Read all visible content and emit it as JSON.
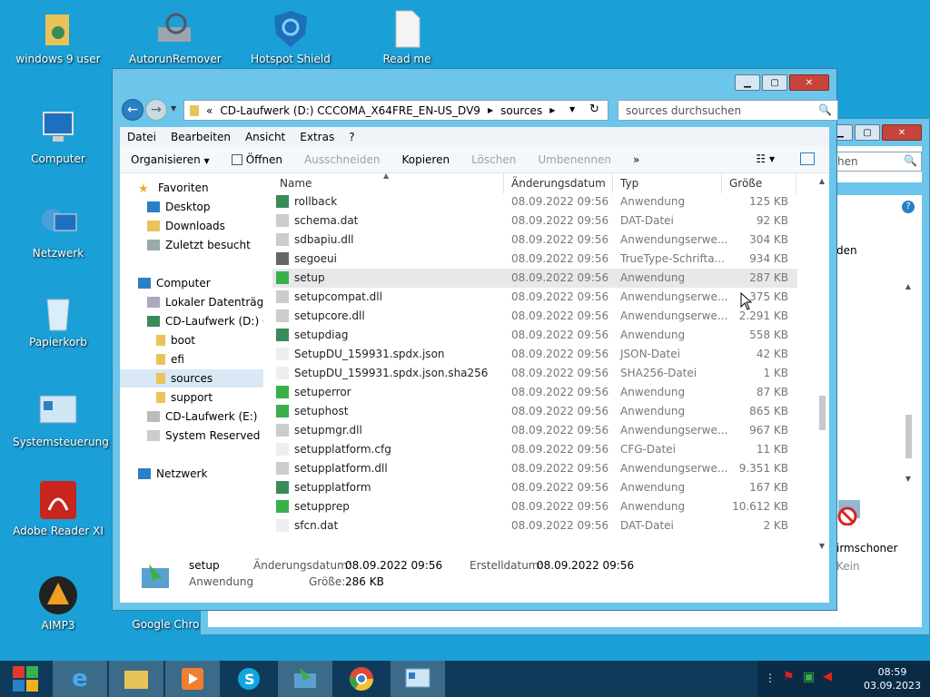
{
  "desktop": {
    "icons": [
      {
        "label": "windows 9 user"
      },
      {
        "label": "AutorunRemover"
      },
      {
        "label": "Hotspot Shield"
      },
      {
        "label": "Read me"
      },
      {
        "label": "Computer"
      },
      {
        "label": "Netzwerk"
      },
      {
        "label": "Papierkorb"
      },
      {
        "label": "Systemsteuerung"
      },
      {
        "label": "Adobe Reader XI"
      },
      {
        "label": "AIMP3"
      },
      {
        "label": "Google Chrome"
      }
    ]
  },
  "bg_window": {
    "search_partial": "hen",
    "text_partial": "den",
    "icon_label": "irmschoner",
    "icon_sub": "Kein"
  },
  "window": {
    "address": {
      "chevron": "«",
      "segments": [
        "CD-Laufwerk (D:) CCCOMA_X64FRE_EN-US_DV9",
        "sources"
      ]
    },
    "search_placeholder": "sources durchsuchen",
    "menu": [
      "Datei",
      "Bearbeiten",
      "Ansicht",
      "Extras",
      "?"
    ],
    "toolbar": {
      "organize": "Organisieren",
      "open": "Öffnen",
      "cut": "Ausschneiden",
      "copy": "Kopieren",
      "delete": "Löschen",
      "rename": "Umbenennen",
      "more": "»"
    },
    "nav": {
      "favorites": "Favoriten",
      "desktop": "Desktop",
      "downloads": "Downloads",
      "recent": "Zuletzt besucht",
      "computer": "Computer",
      "local": "Lokaler Datenträger",
      "cd_d": "CD-Laufwerk (D:) CC",
      "boot": "boot",
      "efi": "efi",
      "sources": "sources",
      "support": "support",
      "cd_e": "CD-Laufwerk (E:)",
      "sysres": "System Reserved (F:)",
      "network": "Netzwerk"
    },
    "columns": {
      "name": "Name",
      "date": "Änderungsdatum",
      "type": "Typ",
      "size": "Größe"
    },
    "files": [
      {
        "name": "rollback",
        "date": "08.09.2022 09:56",
        "type": "Anwendung",
        "size": "125 KB"
      },
      {
        "name": "schema.dat",
        "date": "08.09.2022 09:56",
        "type": "DAT-Datei",
        "size": "92 KB"
      },
      {
        "name": "sdbapiu.dll",
        "date": "08.09.2022 09:56",
        "type": "Anwendungserwe...",
        "size": "304 KB"
      },
      {
        "name": "segoeui",
        "date": "08.09.2022 09:56",
        "type": "TrueType-Schrifta...",
        "size": "934 KB"
      },
      {
        "name": "setup",
        "date": "08.09.2022 09:56",
        "type": "Anwendung",
        "size": "287 KB"
      },
      {
        "name": "setupcompat.dll",
        "date": "08.09.2022 09:56",
        "type": "Anwendungserwe...",
        "size": "375 KB"
      },
      {
        "name": "setupcore.dll",
        "date": "08.09.2022 09:56",
        "type": "Anwendungserwe...",
        "size": "2.291 KB"
      },
      {
        "name": "setupdiag",
        "date": "08.09.2022 09:56",
        "type": "Anwendung",
        "size": "558 KB"
      },
      {
        "name": "SetupDU_159931.spdx.json",
        "date": "08.09.2022 09:56",
        "type": "JSON-Datei",
        "size": "42 KB"
      },
      {
        "name": "SetupDU_159931.spdx.json.sha256",
        "date": "08.09.2022 09:56",
        "type": "SHA256-Datei",
        "size": "1 KB"
      },
      {
        "name": "setuperror",
        "date": "08.09.2022 09:56",
        "type": "Anwendung",
        "size": "87 KB"
      },
      {
        "name": "setuphost",
        "date": "08.09.2022 09:56",
        "type": "Anwendung",
        "size": "865 KB"
      },
      {
        "name": "setupmgr.dll",
        "date": "08.09.2022 09:56",
        "type": "Anwendungserwe...",
        "size": "967 KB"
      },
      {
        "name": "setupplatform.cfg",
        "date": "08.09.2022 09:56",
        "type": "CFG-Datei",
        "size": "11 KB"
      },
      {
        "name": "setupplatform.dll",
        "date": "08.09.2022 09:56",
        "type": "Anwendungserwe...",
        "size": "9.351 KB"
      },
      {
        "name": "setupplatform",
        "date": "08.09.2022 09:56",
        "type": "Anwendung",
        "size": "167 KB"
      },
      {
        "name": "setupprep",
        "date": "08.09.2022 09:56",
        "type": "Anwendung",
        "size": "10.612 KB"
      },
      {
        "name": "sfcn.dat",
        "date": "08.09.2022 09:56",
        "type": "DAT-Datei",
        "size": "2 KB"
      }
    ],
    "details": {
      "name": "setup",
      "type": "Anwendung",
      "mod_label": "Änderungsdatum:",
      "mod_value": "08.09.2022 09:56",
      "created_label": "Erstelldatum:",
      "created_value": "08.09.2022 09:56",
      "size_label": "Größe:",
      "size_value": "286 KB"
    }
  },
  "taskbar": {
    "time": "08:59",
    "date": "03.09.2023"
  }
}
